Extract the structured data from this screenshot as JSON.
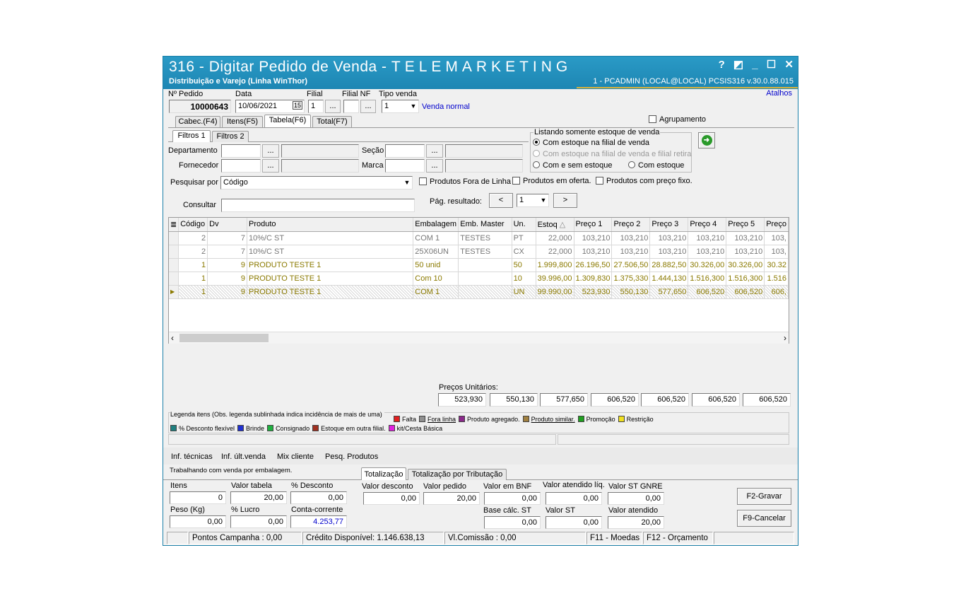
{
  "titlebar": {
    "title_prefix": "316 - Digitar Pedido de Venda - ",
    "title_spaced": "TELEMARKETING",
    "subtitle": "Distribuição e Varejo (Linha WinThor)",
    "session": "1 - PCADMIN (LOCAL@LOCAL)   PCSIS316  v.30.0.88.015",
    "help": "?",
    "atalhos": "Atalhos"
  },
  "header": {
    "pedido_label": "Nº Pedido",
    "pedido_value": "10000643",
    "data_label": "Data",
    "data_value": "10/06/2021",
    "filial_label": "Filial",
    "filial_value": "1",
    "filialnf_label": "Filial NF",
    "filialnf_value": "",
    "tipovenda_label": "Tipo venda",
    "tipovenda_value": "1",
    "tipovenda_desc": "Venda normal",
    "ellipsis": "...",
    "cal_icon": "15"
  },
  "tabs": [
    "Cabec.(F4)",
    "Itens(F5)",
    "Tabela(F6)",
    "Total(F7)"
  ],
  "agrupamento": "Agrupamento",
  "filter_tabs": [
    "Filtros 1",
    "Filtros 2"
  ],
  "filters": {
    "departamento": "Departamento",
    "fornecedor": "Fornecedor",
    "secao": "Seção",
    "marca": "Marca",
    "pesquisar_label": "Pesquisar por",
    "pesquisar_value": "Código",
    "consultar_label": "Consultar",
    "fora_linha": "Produtos Fora de Linha",
    "em_oferta": "Produtos em oferta.",
    "preco_fixo": "Produtos com preço fixo.",
    "pag_label": "Pág. resultado:",
    "pag_value": "1",
    "prev": "<",
    "next": ">"
  },
  "estoque": {
    "title": "Listando somente estoque de venda",
    "opt1": "Com estoque na filial de venda",
    "opt2": "Com estoque na filial de venda e filial retira",
    "opt3": "Com e sem estoque",
    "opt4": "Com estoque"
  },
  "grid": {
    "headers": [
      "Código",
      "Dv",
      "Produto",
      "Embalagem",
      "Emb. Master",
      "Un.",
      "Estoq",
      "Preço 1",
      "Preço 2",
      "Preço 3",
      "Preço 4",
      "Preço 5",
      "Preço"
    ],
    "rows": [
      [
        "2",
        "7",
        "10%/C ST",
        "COM 1",
        "TESTES",
        "PT",
        "22,000",
        "103,210",
        "103,210",
        "103,210",
        "103,210",
        "103,210",
        "103,"
      ],
      [
        "2",
        "7",
        "10%/C ST",
        "25X06UN",
        "TESTES",
        "CX",
        "22,000",
        "103,210",
        "103,210",
        "103,210",
        "103,210",
        "103,210",
        "103,"
      ],
      [
        "1",
        "9",
        "PRODUTO TESTE 1",
        "50 unid",
        "",
        "50",
        "1.999,800",
        "26.196,50",
        "27.506,50",
        "28.882,50",
        "30.326,00",
        "30.326,00",
        "30.32"
      ],
      [
        "1",
        "9",
        "PRODUTO TESTE 1",
        "Com 10",
        "",
        "10",
        "39.996,00",
        "1.309,830",
        "1.375,330",
        "1.444,130",
        "1.516,300",
        "1.516,300",
        "1.516"
      ],
      [
        "1",
        "9",
        "PRODUTO TESTE 1",
        "COM 1",
        "",
        "UN",
        "99.990,00",
        "523,930",
        "550,130",
        "577,650",
        "606,520",
        "606,520",
        "606,"
      ]
    ]
  },
  "precos_unitarios": {
    "label": "Preços Unitários:",
    "values": [
      "523,930",
      "550,130",
      "577,650",
      "606,520",
      "606,520",
      "606,520",
      "606,520"
    ]
  },
  "legend": {
    "title": "Legenda itens (Obs. legenda sublinhada indica incidência de mais de uma)",
    "items": [
      {
        "label": "Falta",
        "color": "#e02020"
      },
      {
        "label": "Fora linha",
        "color": "#909090"
      },
      {
        "label": "Produto agregado.",
        "color": "#8b2a8b"
      },
      {
        "label": "Produto similar.",
        "color": "#a08040"
      },
      {
        "label": "Promoção",
        "color": "#20a020"
      },
      {
        "label": "Restrição",
        "color": "#f0e020"
      },
      {
        "label": "% Desconto flexível",
        "color": "#208080"
      },
      {
        "label": "Brinde",
        "color": "#2030d0"
      },
      {
        "label": "Consignado",
        "color": "#20b040"
      },
      {
        "label": "Estoque em outra filial.",
        "color": "#a03020"
      },
      {
        "label": "kit/Cesta Básica",
        "color": "#e020e0"
      }
    ]
  },
  "info_links": [
    "Inf. técnicas",
    "Inf. últ.venda",
    "Mix cliente",
    "Pesq. Produtos"
  ],
  "trabalhando": "Trabalhando com venda por embalagem.",
  "tot_tabs": [
    "Totalização",
    "Totalização por Tributação"
  ],
  "totals": {
    "itens_label": "Itens",
    "itens": "0",
    "valor_tabela_label": "Valor tabela",
    "valor_tabela": "20,00",
    "desconto_label": "% Desconto",
    "desconto": "0,00",
    "peso_label": "Peso (Kg)",
    "peso": "0,00",
    "lucro_label": "% Lucro",
    "lucro": "0,00",
    "cc_label": "Conta-corrente",
    "cc": "4.253,77",
    "valor_desconto_label": "Valor desconto",
    "valor_desconto": "0,00",
    "valor_pedido_label": "Valor pedido",
    "valor_pedido": "20,00",
    "valor_bnf_label": "Valor em BNF",
    "valor_bnf": "0,00",
    "valor_atendido_liq_label": "Valor atendido líq.",
    "valor_atendido_liq": "0,00",
    "st_gnre_label": "Valor ST GNRE",
    "st_gnre": "0,00",
    "base_st_label": "Base cálc. ST",
    "base_st": "0,00",
    "valor_st_label": "Valor ST",
    "valor_st": "0,00",
    "valor_atendido_label": "Valor atendido",
    "valor_atendido": "20,00"
  },
  "buttons": {
    "gravar": "F2-Gravar",
    "cancelar": "F9-Cancelar"
  },
  "status": {
    "pontos": "Pontos Campanha : 0,00",
    "credito": "Crédito Disponível: 1.146.638,13",
    "comissao": "Vl.Comissão : 0,00",
    "moedas": "F11 - Moedas",
    "orcamento": "F12 - Orçamento"
  }
}
